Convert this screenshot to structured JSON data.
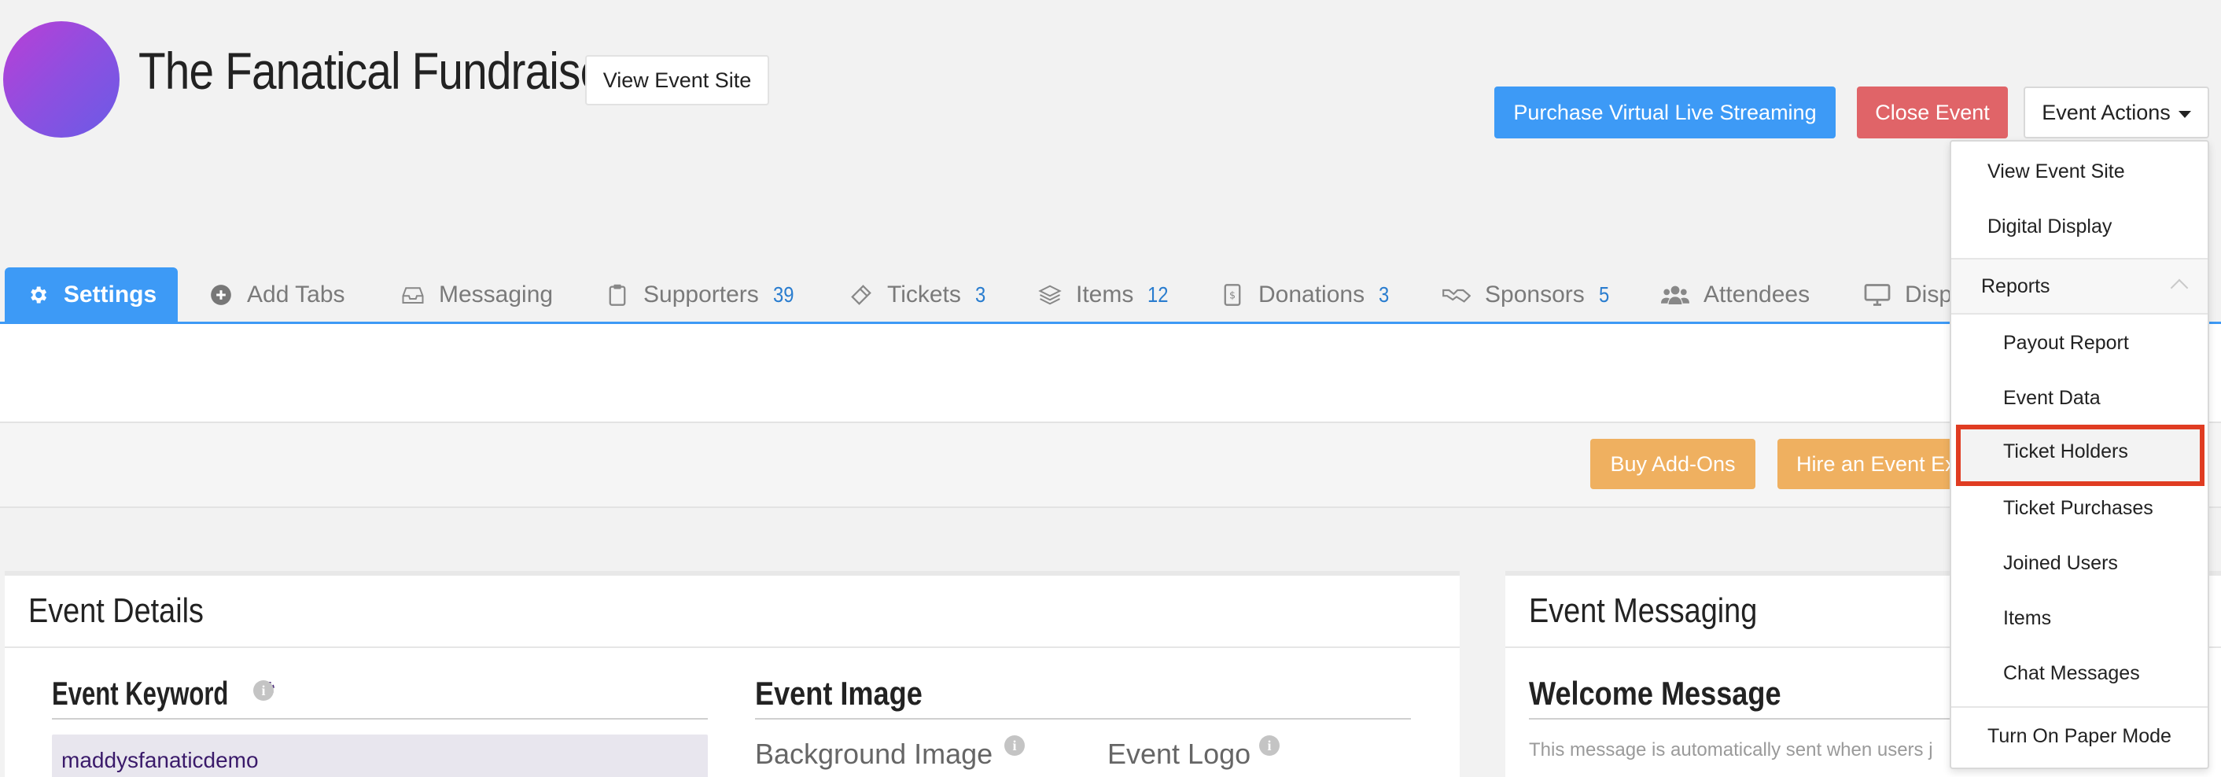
{
  "header": {
    "event_title": "The Fanatical Fundraiser",
    "view_event_site": "View Event Site",
    "purchase_streaming": "Purchase Virtual Live Streaming",
    "close_event": "Close Event",
    "event_actions": "Event Actions"
  },
  "tabs": [
    {
      "label": "Settings",
      "icon": "gear-icon",
      "active": true
    },
    {
      "label": "Add Tabs",
      "icon": "plus-circle-icon"
    },
    {
      "label": "Messaging",
      "icon": "inbox-icon"
    },
    {
      "label": "Supporters",
      "icon": "clipboard-icon",
      "count": "39"
    },
    {
      "label": "Tickets",
      "icon": "ticket-icon",
      "count": "3"
    },
    {
      "label": "Items",
      "icon": "layers-icon",
      "count": "12"
    },
    {
      "label": "Donations",
      "icon": "donation-icon",
      "count": "3"
    },
    {
      "label": "Sponsors",
      "icon": "handshake-icon",
      "count": "5"
    },
    {
      "label": "Attendees",
      "icon": "users-icon"
    },
    {
      "label": "Displ",
      "icon": "monitor-icon"
    }
  ],
  "actions": {
    "buy_addons": "Buy Add-Ons",
    "hire_expert": "Hire an Event Ex"
  },
  "event_details": {
    "title": "Event Details",
    "keyword_label": "Event Keyword",
    "required_mark": "*",
    "keyword_value": "maddysfanaticdemo",
    "image_heading": "Event Image",
    "background_image": "Background Image",
    "event_logo": "Event Logo"
  },
  "event_messaging": {
    "title": "Event Messaging",
    "welcome_heading": "Welcome Message",
    "welcome_hint": "This message is automatically sent when users j"
  },
  "dropdown": {
    "view_event_site": "View Event Site",
    "digital_display": "Digital Display",
    "reports": "Reports",
    "report_items": [
      "Payout Report",
      "Event Data",
      "Ticket Holders",
      "Ticket Purchases",
      "Joined Users",
      "Items",
      "Chat Messages"
    ],
    "paper_mode": "Turn On Paper Mode"
  },
  "colors": {
    "accent_blue": "#3d9af6",
    "danger_red": "#e06468",
    "orange": "#efb060",
    "highlight_red": "#e03c22",
    "count_blue": "#2a7dcf"
  }
}
